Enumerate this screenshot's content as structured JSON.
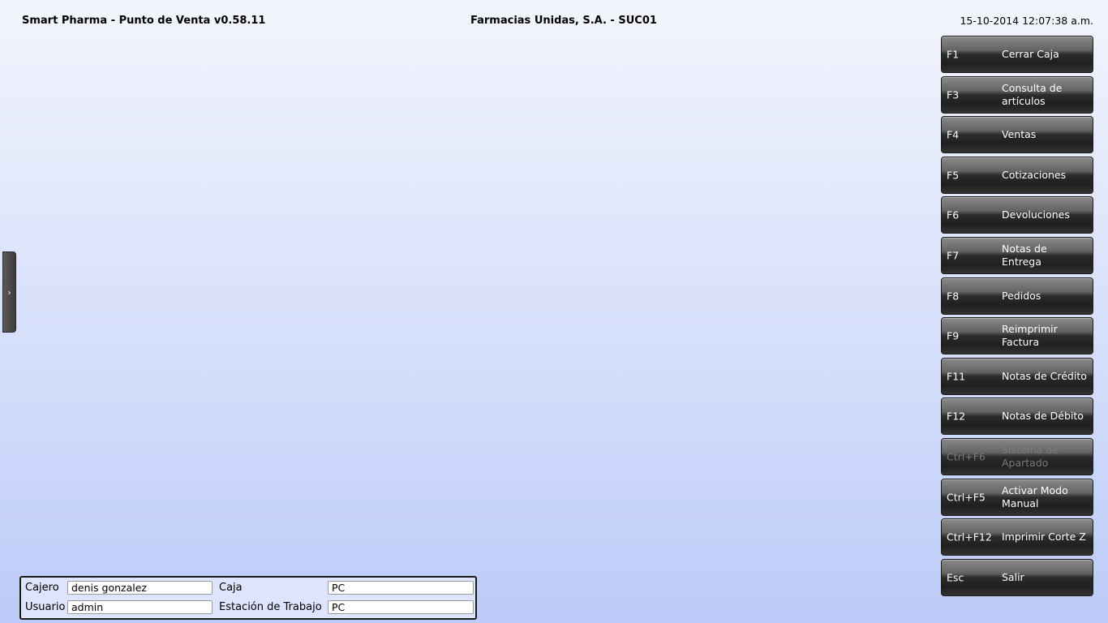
{
  "header": {
    "app_title": "Smart Pharma - Punto de Venta  v0.58.11",
    "company": "Farmacias Unidas, S.A.   -   SUC01",
    "datetime": "15-10-2014 12:07:38 a.m."
  },
  "side_tab": {
    "glyph": "›"
  },
  "menu": [
    {
      "key": "F1",
      "label": "Cerrar Caja",
      "enabled": true
    },
    {
      "key": "F3",
      "label": "Consulta de artículos",
      "enabled": true
    },
    {
      "key": "F4",
      "label": "Ventas",
      "enabled": true
    },
    {
      "key": "F5",
      "label": "Cotizaciones",
      "enabled": true
    },
    {
      "key": "F6",
      "label": "Devoluciones",
      "enabled": true
    },
    {
      "key": "F7",
      "label": "Notas de Entrega",
      "enabled": true
    },
    {
      "key": "F8",
      "label": "Pedidos",
      "enabled": true
    },
    {
      "key": "F9",
      "label": "Reimprimir Factura",
      "enabled": true
    },
    {
      "key": "F11",
      "label": "Notas de Crédito",
      "enabled": true
    },
    {
      "key": "F12",
      "label": "Notas de Débito",
      "enabled": true
    },
    {
      "key": "Ctrl+F6",
      "label": "Sistema de Apartado",
      "enabled": false
    },
    {
      "key": "Ctrl+F5",
      "label": "Activar Modo Manual",
      "enabled": true
    },
    {
      "key": "Ctrl+F12",
      "label": "Imprimir Corte Z",
      "enabled": true
    },
    {
      "key": "Esc",
      "label": "Salir",
      "enabled": true
    }
  ],
  "info": {
    "cajero_label": "Cajero",
    "cajero_value": "denis gonzalez",
    "usuario_label": "Usuario",
    "usuario_value": "admin",
    "caja_label": "Caja",
    "caja_value": "PC",
    "estacion_label": "Estación de Trabajo",
    "estacion_value": "PC"
  }
}
